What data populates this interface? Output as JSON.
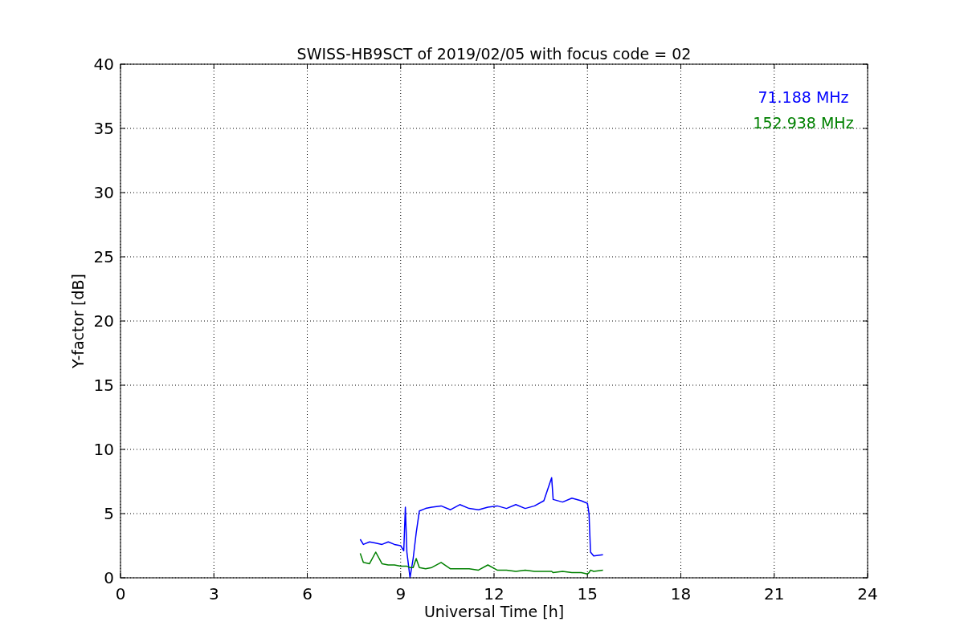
{
  "figure": {
    "chart_data": {
      "type": "line",
      "title": "SWISS-HB9SCT of 2019/02/05 with focus code = 02",
      "xlabel": "Universal Time [h]",
      "ylabel": "Y-factor [dB]",
      "x": [
        7.7,
        7.8,
        8.0,
        8.2,
        8.4,
        8.6,
        8.8,
        9.0,
        9.1,
        9.15,
        9.2,
        9.3,
        9.4,
        9.5,
        9.6,
        9.8,
        10.0,
        10.3,
        10.6,
        10.9,
        11.2,
        11.5,
        11.8,
        12.1,
        12.4,
        12.7,
        13.0,
        13.3,
        13.6,
        13.85,
        13.9,
        14.2,
        14.5,
        14.8,
        15.0,
        15.05,
        15.1,
        15.2,
        15.5
      ],
      "series": [
        {
          "name": "71.188 MHz",
          "color": "#0000ff",
          "values": [
            3.0,
            2.6,
            2.8,
            2.7,
            2.6,
            2.8,
            2.6,
            2.5,
            2.1,
            5.5,
            2.0,
            0.0,
            1.5,
            3.5,
            5.2,
            5.4,
            5.5,
            5.6,
            5.3,
            5.7,
            5.4,
            5.3,
            5.5,
            5.6,
            5.4,
            5.7,
            5.4,
            5.6,
            6.0,
            7.8,
            6.1,
            5.9,
            6.2,
            6.0,
            5.8,
            5.0,
            2.0,
            1.7,
            1.8
          ]
        },
        {
          "name": "152.938 MHz",
          "color": "#008000",
          "values": [
            1.9,
            1.2,
            1.1,
            2.0,
            1.1,
            1.0,
            1.0,
            0.9,
            0.9,
            0.9,
            0.9,
            0.8,
            0.8,
            1.5,
            0.8,
            0.7,
            0.8,
            1.2,
            0.7,
            0.7,
            0.7,
            0.6,
            1.0,
            0.6,
            0.6,
            0.5,
            0.6,
            0.5,
            0.5,
            0.5,
            0.4,
            0.5,
            0.4,
            0.4,
            0.3,
            0.4,
            0.6,
            0.5,
            0.6
          ]
        }
      ],
      "grid": true,
      "xlim": [
        0,
        24
      ],
      "ylim": [
        0,
        40
      ],
      "xticks": [
        0,
        3,
        6,
        9,
        12,
        15,
        18,
        21,
        24
      ],
      "yticks": [
        0,
        5,
        10,
        15,
        20,
        25,
        30,
        35,
        40
      ]
    }
  }
}
